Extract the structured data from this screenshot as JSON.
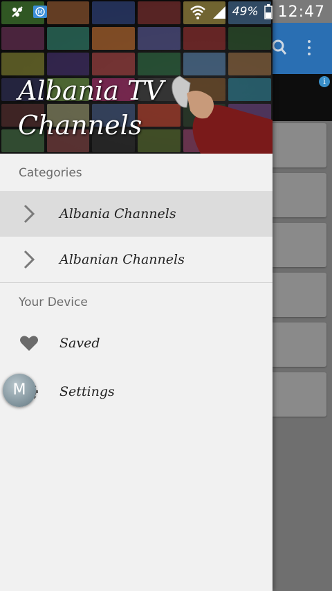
{
  "status_bar": {
    "battery_text": "49%",
    "time": "12:47"
  },
  "drawer": {
    "title_line1": "Albania TV",
    "title_line2": "Channels",
    "categories_header": "Categories",
    "categories": [
      {
        "label": "Albania Channels",
        "selected": true
      },
      {
        "label": "Albanian Channels",
        "selected": false
      }
    ],
    "device_header": "Your Device",
    "device_items": [
      {
        "label": "Saved",
        "icon": "heart-icon"
      },
      {
        "label": "Settings",
        "icon": "gear-icon"
      }
    ]
  },
  "overlay_button": {
    "label": "M"
  },
  "background_app": {
    "ad_info_label": "i"
  },
  "colors": {
    "toolbar": "#2a6fb3",
    "drawer_bg": "#f1f1f1",
    "selected_row": "#dcdcdc"
  }
}
